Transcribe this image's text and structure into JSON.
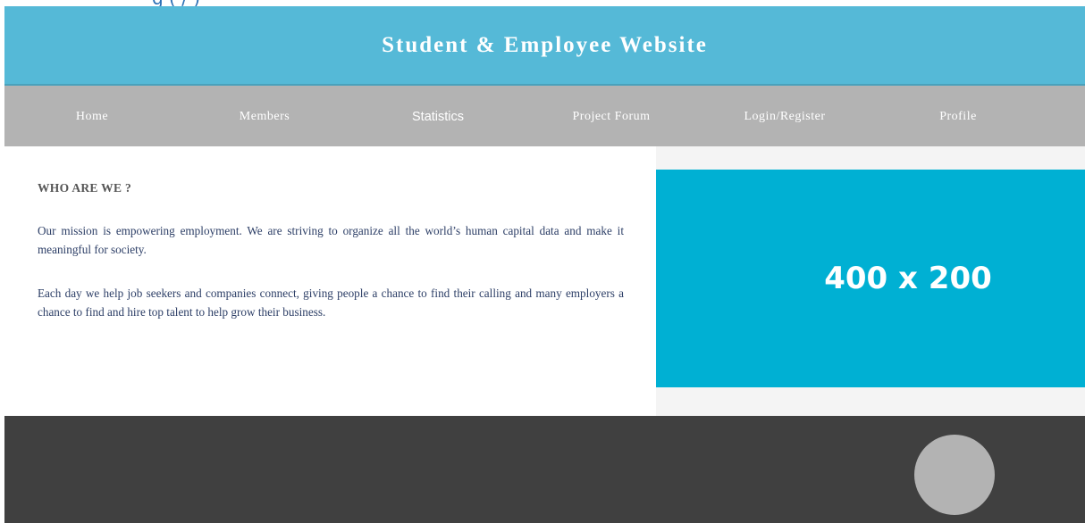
{
  "header": {
    "title": "Student & Employee Website"
  },
  "nav": {
    "items": [
      {
        "label": "Home"
      },
      {
        "label": "Members"
      },
      {
        "label": "Statistics"
      },
      {
        "label": "Project Forum"
      },
      {
        "label": "Login/Register"
      },
      {
        "label": "Profile"
      }
    ]
  },
  "about": {
    "heading": "WHO ARE WE ?",
    "paragraphs": [
      "Our mission is empowering employment. We are striving to organize all the world’s human capital data and make it meaningful for society.",
      "Each day we help job seekers and companies connect, giving people a chance to find their calling and many employers a chance to find and hire top talent to help grow their business."
    ]
  },
  "hero_image": {
    "label": "400 x 200"
  },
  "colors": {
    "header_bg": "#55b9d7",
    "nav_bg": "#b3b3b3",
    "image_bg": "#00b0d3",
    "footer_bg": "#404040"
  }
}
